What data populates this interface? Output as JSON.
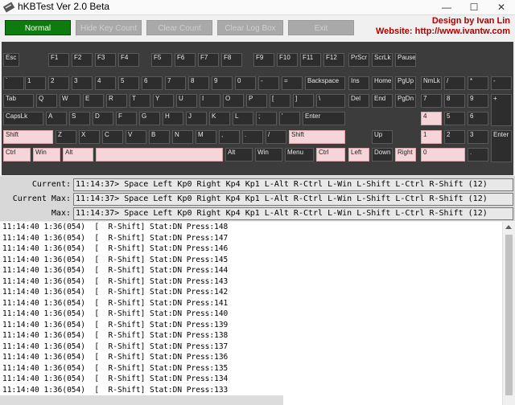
{
  "window": {
    "title": "hKBTest Ver 2.0 Beta"
  },
  "toolbar": {
    "buttons": [
      {
        "label": "Normal",
        "active": true
      },
      {
        "label": "Hide Key Count",
        "active": false
      },
      {
        "label": "Clear Count",
        "active": false
      },
      {
        "label": "Clear Log Box",
        "active": false
      },
      {
        "label": "Exit",
        "active": false
      }
    ]
  },
  "credit": {
    "author": "Design by Ivan Lin",
    "website": "Website: http://www.ivantw.com"
  },
  "status": {
    "current_label": "Current:",
    "current_max_label": "Current Max:",
    "max_label": "Max:",
    "current": "11:14:37> Space Left Kp0 Right Kp4 Kp1 L-Alt R-Ctrl L-Win L-Shift L-Ctrl R-Shift (12)",
    "current_max": "11:14:37> Space Left Kp0 Right Kp4 Kp1 L-Alt R-Ctrl L-Win L-Shift L-Ctrl R-Shift (12)",
    "max": "11:14:37> Space Left Kp0 Right Kp4 Kp1 L-Alt R-Ctrl L-Win L-Shift L-Ctrl R-Shift (12)"
  },
  "keyboard": {
    "row_f": [
      "Esc",
      "F1",
      "F2",
      "F3",
      "F4",
      "F5",
      "F6",
      "F7",
      "F8",
      "F9",
      "F10",
      "F11",
      "F12",
      "PrScr",
      "ScrLk",
      "Pause"
    ],
    "row_num": [
      "`",
      "1",
      "2",
      "3",
      "4",
      "5",
      "6",
      "7",
      "8",
      "9",
      "0",
      "-",
      "=",
      "Backspace",
      "Ins",
      "Home",
      "PgUp",
      "NmLk",
      "/",
      "*",
      "-"
    ],
    "row_tab": [
      "Tab",
      "Q",
      "W",
      "E",
      "R",
      "T",
      "Y",
      "U",
      "I",
      "O",
      "P",
      "[",
      "]",
      "\\",
      "Del",
      "End",
      "PgDn",
      "7",
      "8",
      "9",
      "+"
    ],
    "row_caps": [
      "CapsLk",
      "A",
      "S",
      "D",
      "F",
      "G",
      "H",
      "J",
      "K",
      "L",
      ";",
      "'",
      "Enter",
      "4",
      "5",
      "6"
    ],
    "row_shift": [
      "Shift",
      "Z",
      "X",
      "C",
      "V",
      "B",
      "N",
      "M",
      ",",
      ".",
      "/",
      "Shift",
      "Up",
      "1",
      "2",
      "3",
      "Enter"
    ],
    "row_ctrl": [
      "Ctrl",
      "Win",
      "Alt",
      "",
      "Alt",
      "Win",
      "Menu",
      "Ctrl",
      "Left",
      "Down",
      "Right",
      "0",
      "."
    ],
    "pressed": [
      "L-Shift",
      "L-Ctrl",
      "L-Win",
      "L-Alt",
      "Space",
      "R-Shift",
      "R-Ctrl",
      "Left",
      "Right",
      "Kp0",
      "Kp4",
      "Kp1"
    ]
  },
  "log": [
    "11:14:40 1:36(054)  [  R-Shift] Stat:DN Press:148",
    "11:14:40 1:36(054)  [  R-Shift] Stat:DN Press:147",
    "11:14:40 1:36(054)  [  R-Shift] Stat:DN Press:146",
    "11:14:40 1:36(054)  [  R-Shift] Stat:DN Press:145",
    "11:14:40 1:36(054)  [  R-Shift] Stat:DN Press:144",
    "11:14:40 1:36(054)  [  R-Shift] Stat:DN Press:143",
    "11:14:40 1:36(054)  [  R-Shift] Stat:DN Press:142",
    "11:14:40 1:36(054)  [  R-Shift] Stat:DN Press:141",
    "11:14:40 1:36(054)  [  R-Shift] Stat:DN Press:140",
    "11:14:40 1:36(054)  [  R-Shift] Stat:DN Press:139",
    "11:14:40 1:36(054)  [  R-Shift] Stat:DN Press:138",
    "11:14:40 1:36(054)  [  R-Shift] Stat:DN Press:137",
    "11:14:40 1:36(054)  [  R-Shift] Stat:DN Press:136",
    "11:14:40 1:36(054)  [  R-Shift] Stat:DN Press:135",
    "11:14:40 1:36(054)  [  R-Shift] Stat:DN Press:134",
    "11:14:40 1:36(054)  [  R-Shift] Stat:DN Press:133"
  ],
  "colors": {
    "active_button": "#0e7b0e",
    "pressed_key": "#f5d5d9",
    "credit": "#b00000"
  },
  "icons": {
    "app": "keyboard-icon",
    "minimize": "minimize-icon",
    "maximize": "maximize-icon",
    "close": "close-icon"
  }
}
